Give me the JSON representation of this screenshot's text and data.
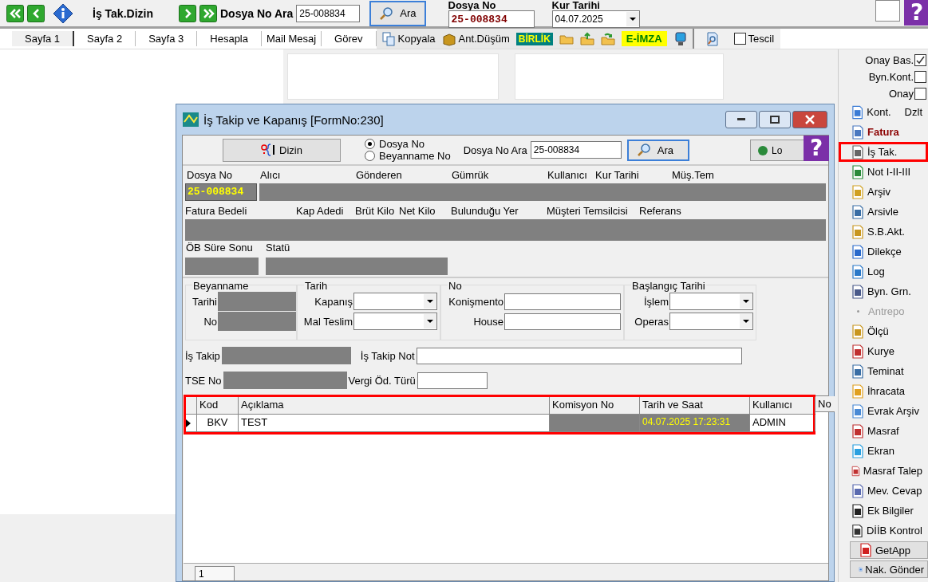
{
  "toolbar": {
    "title": "İş Tak.Dizin",
    "search_label": "Dosya No Ara",
    "search_value": "25-008834",
    "search_button": "Ara",
    "dosya_no_label": "Dosya No",
    "dosya_no_value": "25-008834",
    "kur_tarihi_label": "Kur Tarihi",
    "kur_tarihi_value": "04.07.2025",
    "help": "?"
  },
  "tabs": [
    {
      "label": "Sayfa 1",
      "selected": true
    },
    {
      "label": "Sayfa 2",
      "selected": false
    },
    {
      "label": "Sayfa 3",
      "selected": false
    },
    {
      "label": "Hesapla",
      "selected": false
    },
    {
      "label": "Mail Mesaj",
      "selected": false
    },
    {
      "label": "Görev",
      "selected": false
    }
  ],
  "tools": [
    {
      "kind": "copy",
      "label": "Kopyala"
    },
    {
      "kind": "box",
      "label": "Ant.Düşüm"
    },
    {
      "kind": "badge",
      "label": "BİRLİK"
    },
    {
      "kind": "folder"
    },
    {
      "kind": "folder-up"
    },
    {
      "kind": "folder-arrow"
    },
    {
      "kind": "sign",
      "label": "E-İMZA"
    },
    {
      "kind": "monitor"
    }
  ],
  "tescil": {
    "label": "Tescil",
    "checked": false
  },
  "sidebar": {
    "checks": [
      {
        "label": "Onay Bas.",
        "checked": true
      },
      {
        "label": "Byn.Kont.",
        "checked": false
      },
      {
        "label": "Onay",
        "checked": false
      }
    ],
    "items": [
      {
        "kind": "normal",
        "label": "Kont.",
        "extra": "Dzlt",
        "highlighted": false
      },
      {
        "kind": "bold",
        "label": "Fatura",
        "highlighted": false
      },
      {
        "kind": "normal",
        "label": "İş Tak.",
        "highlighted": true
      },
      {
        "kind": "normal",
        "label": "Not I-II-III",
        "highlighted": false
      },
      {
        "kind": "normal",
        "label": "Arşiv",
        "highlighted": false
      },
      {
        "kind": "normal",
        "label": "Arsivle",
        "highlighted": false
      },
      {
        "kind": "normal",
        "label": "S.B.Akt.",
        "highlighted": false
      },
      {
        "kind": "normal",
        "label": "Dilekçe",
        "highlighted": false
      },
      {
        "kind": "normal",
        "label": "Log",
        "highlighted": false
      },
      {
        "kind": "normal",
        "label": "Byn. Grn.",
        "highlighted": false
      },
      {
        "kind": "disabled",
        "label": "Antrepo",
        "highlighted": false
      },
      {
        "kind": "normal",
        "label": "Ölçü",
        "highlighted": false
      },
      {
        "kind": "normal",
        "label": "Kurye",
        "highlighted": false
      },
      {
        "kind": "normal",
        "label": "Teminat",
        "highlighted": false
      },
      {
        "kind": "normal",
        "label": "İhracata",
        "highlighted": false
      },
      {
        "kind": "normal",
        "label": "Evrak Arşiv",
        "highlighted": false
      },
      {
        "kind": "normal",
        "label": "Masraf",
        "highlighted": false
      },
      {
        "kind": "normal",
        "label": "Ekran",
        "highlighted": false
      },
      {
        "kind": "normal",
        "label": "Masraf Talep",
        "highlighted": false
      },
      {
        "kind": "normal",
        "label": "Mev. Cevap",
        "highlighted": false
      },
      {
        "kind": "normal",
        "label": "Ek Bilgiler",
        "highlighted": false
      },
      {
        "kind": "normal",
        "label": "DİİB Kontrol",
        "highlighted": false
      },
      {
        "kind": "button",
        "label": "GetApp",
        "highlighted": false
      },
      {
        "kind": "button",
        "label": "Nak. Gönder",
        "highlighted": false
      }
    ]
  },
  "dialog": {
    "title": "İş Takip ve Kapanış [FormNo:230]",
    "dizin_button": "Dizin",
    "radios": [
      {
        "label": "Dosya No",
        "selected": true
      },
      {
        "label": "Beyanname No",
        "selected": false
      }
    ],
    "search_label": "Dosya No Ara",
    "search_value": "25-008834",
    "search_button": "Ara",
    "log_button": "Lo",
    "help": "?",
    "info_row_1": [
      "Dosya No",
      "Alıcı",
      "Gönderen",
      "Gümrük",
      "Kullanıcı",
      "Kur Tarihi",
      "Müş.Tem"
    ],
    "dosya_no_value": "25-008834",
    "info_row_2": [
      "Fatura Bedeli",
      "Kap Adedi",
      "Brüt Kilo",
      "Net Kilo",
      "Bulunduğu Yer",
      "Müşteri Temsilcisi",
      "Referans"
    ],
    "info_row_3": [
      "ÖB Süre Sonu",
      "Statü"
    ],
    "groups": [
      {
        "title": "Beyanname",
        "fields": [
          {
            "kind": "masked",
            "label": "Tarihi"
          },
          {
            "kind": "masked",
            "label": "No"
          }
        ]
      },
      {
        "title": "Tarih",
        "fields": [
          {
            "kind": "dropdown",
            "label": "Kapanış"
          },
          {
            "kind": "dropdown",
            "label": "Mal Teslim"
          }
        ]
      },
      {
        "title": "No",
        "fields": [
          {
            "kind": "input",
            "label": "Konişmento"
          },
          {
            "kind": "input",
            "label": "House"
          }
        ]
      },
      {
        "title": "Başlangıç Tarihi",
        "fields": [
          {
            "kind": "dropdown",
            "label": "İşlem"
          },
          {
            "kind": "dropdown",
            "label": "Operas"
          }
        ]
      }
    ],
    "lines": [
      [
        {
          "kind": "masked",
          "label": "İş Takip"
        },
        {
          "kind": "input",
          "label": "İş Takip Not"
        }
      ],
      [
        {
          "kind": "masked",
          "label": "TSE No"
        },
        {
          "kind": "input",
          "label": "Vergi Öd. Türü"
        }
      ]
    ],
    "grid": {
      "highlighted": true,
      "columns": [
        "Kod",
        "Açıklama",
        "Komisyon No",
        "Tarih ve Saat",
        "Kullanıcı",
        "No"
      ],
      "rows": [
        {
          "selected": true,
          "cells": [
            "BKV",
            "TEST",
            "",
            "04.07.2025 17:23:31",
            "ADMIN"
          ]
        }
      ]
    },
    "footer_value": "1"
  }
}
